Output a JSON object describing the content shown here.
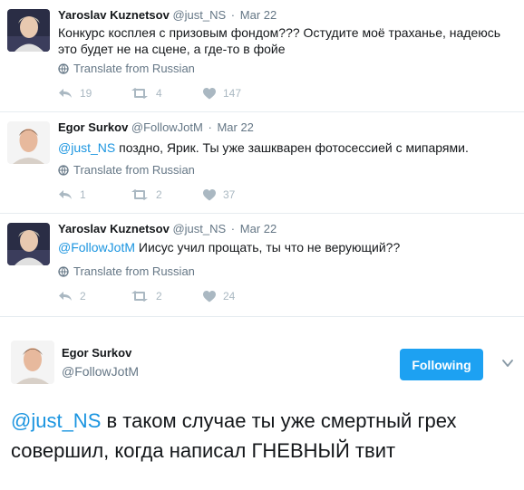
{
  "tweets": [
    {
      "name": "Yaroslav Kuznetsov",
      "handle": "@just_NS",
      "separator": "·",
      "date": "Mar 22",
      "text": "Конкурс косплея с призовым фондом??? Остудите моё траханье, надеюсь это будет не на сцене, а где-то в фойе",
      "mention": "",
      "translate": "Translate from Russian",
      "replies": "19",
      "retweets": "4",
      "likes": "147"
    },
    {
      "name": "Egor Surkov",
      "handle": "@FollowJotM",
      "separator": "·",
      "date": "Mar 22",
      "mention": "@just_NS",
      "text": " поздно, Ярик. Ты уже зашкварен фотосессией с мипарями.",
      "translate": "Translate from Russian",
      "replies": "1",
      "retweets": "2",
      "likes": "37"
    },
    {
      "name": "Yaroslav Kuznetsov",
      "handle": "@just_NS",
      "separator": "·",
      "date": "Mar 22",
      "mention": "@FollowJotM",
      "text": " Иисус учил прощать, ты что не верующий??",
      "translate": "Translate from Russian",
      "replies": "2",
      "retweets": "2",
      "likes": "24"
    }
  ],
  "main_tweet": {
    "name": "Egor Surkov",
    "handle": "@FollowJotM",
    "follow_label": "Following",
    "mention": "@just_NS",
    "text": " в таком случае ты уже смертный грех совершил, когда написал ГНЕВНЫЙ твит"
  },
  "colors": {
    "accent": "#1da1f2",
    "mention": "#1b95e0",
    "muted": "#657786",
    "icon": "#aab8c2"
  },
  "icons": {
    "reply": "reply-icon",
    "retweet": "retweet-icon",
    "like": "heart-icon",
    "globe": "globe-icon",
    "caret": "chevron-down-icon"
  }
}
